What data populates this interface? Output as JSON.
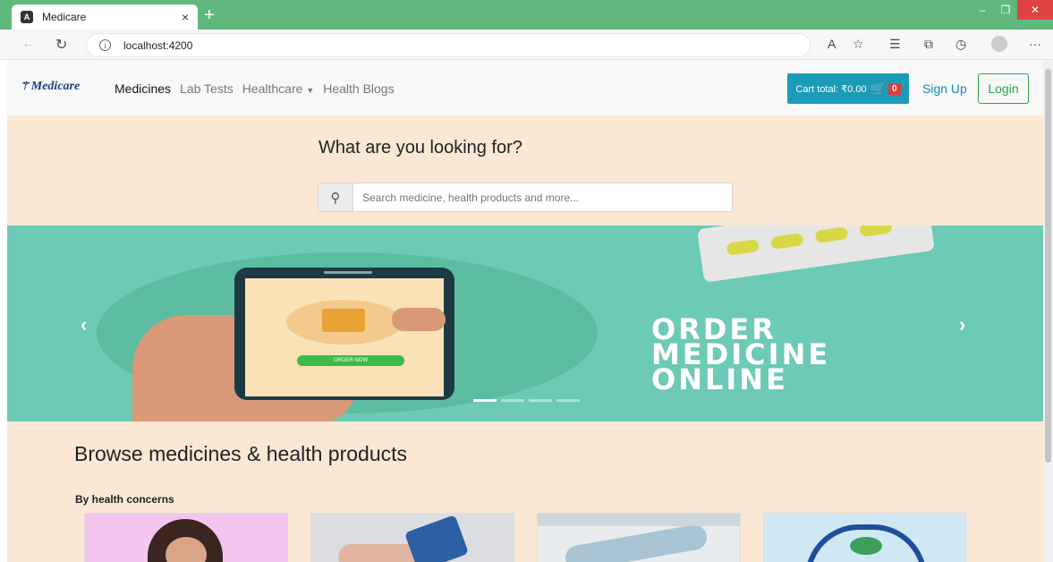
{
  "browser": {
    "tab_title": "Medicare",
    "tab_close": "×",
    "new_tab": "+",
    "url": "localhost:4200",
    "colors": {
      "tabstrip": "#5fb97f",
      "close": "#e04343"
    }
  },
  "navbar": {
    "logo": "Medicare",
    "links": [
      "Medicines",
      "Lab Tests",
      "Healthcare",
      "Health Blogs"
    ],
    "cart_label": "Cart total: ₹0.00",
    "cart_count": "0",
    "signup": "Sign Up",
    "login": "Login",
    "colors": {
      "cart": "#1b9bb5",
      "login": "#28a745",
      "badge": "#e43b3b"
    }
  },
  "hero": {
    "title": "What are you looking for?",
    "search_placeholder": "Search medicine, health products and more..."
  },
  "banner": {
    "order_button": "ORDER NOW",
    "headline_lines": [
      "ORDER",
      "MEDICINE",
      "ONLINE"
    ],
    "indicators": 4,
    "active_indicator": 0
  },
  "browse": {
    "title": "Browse medicines & health products",
    "section_label": "By health concerns"
  }
}
